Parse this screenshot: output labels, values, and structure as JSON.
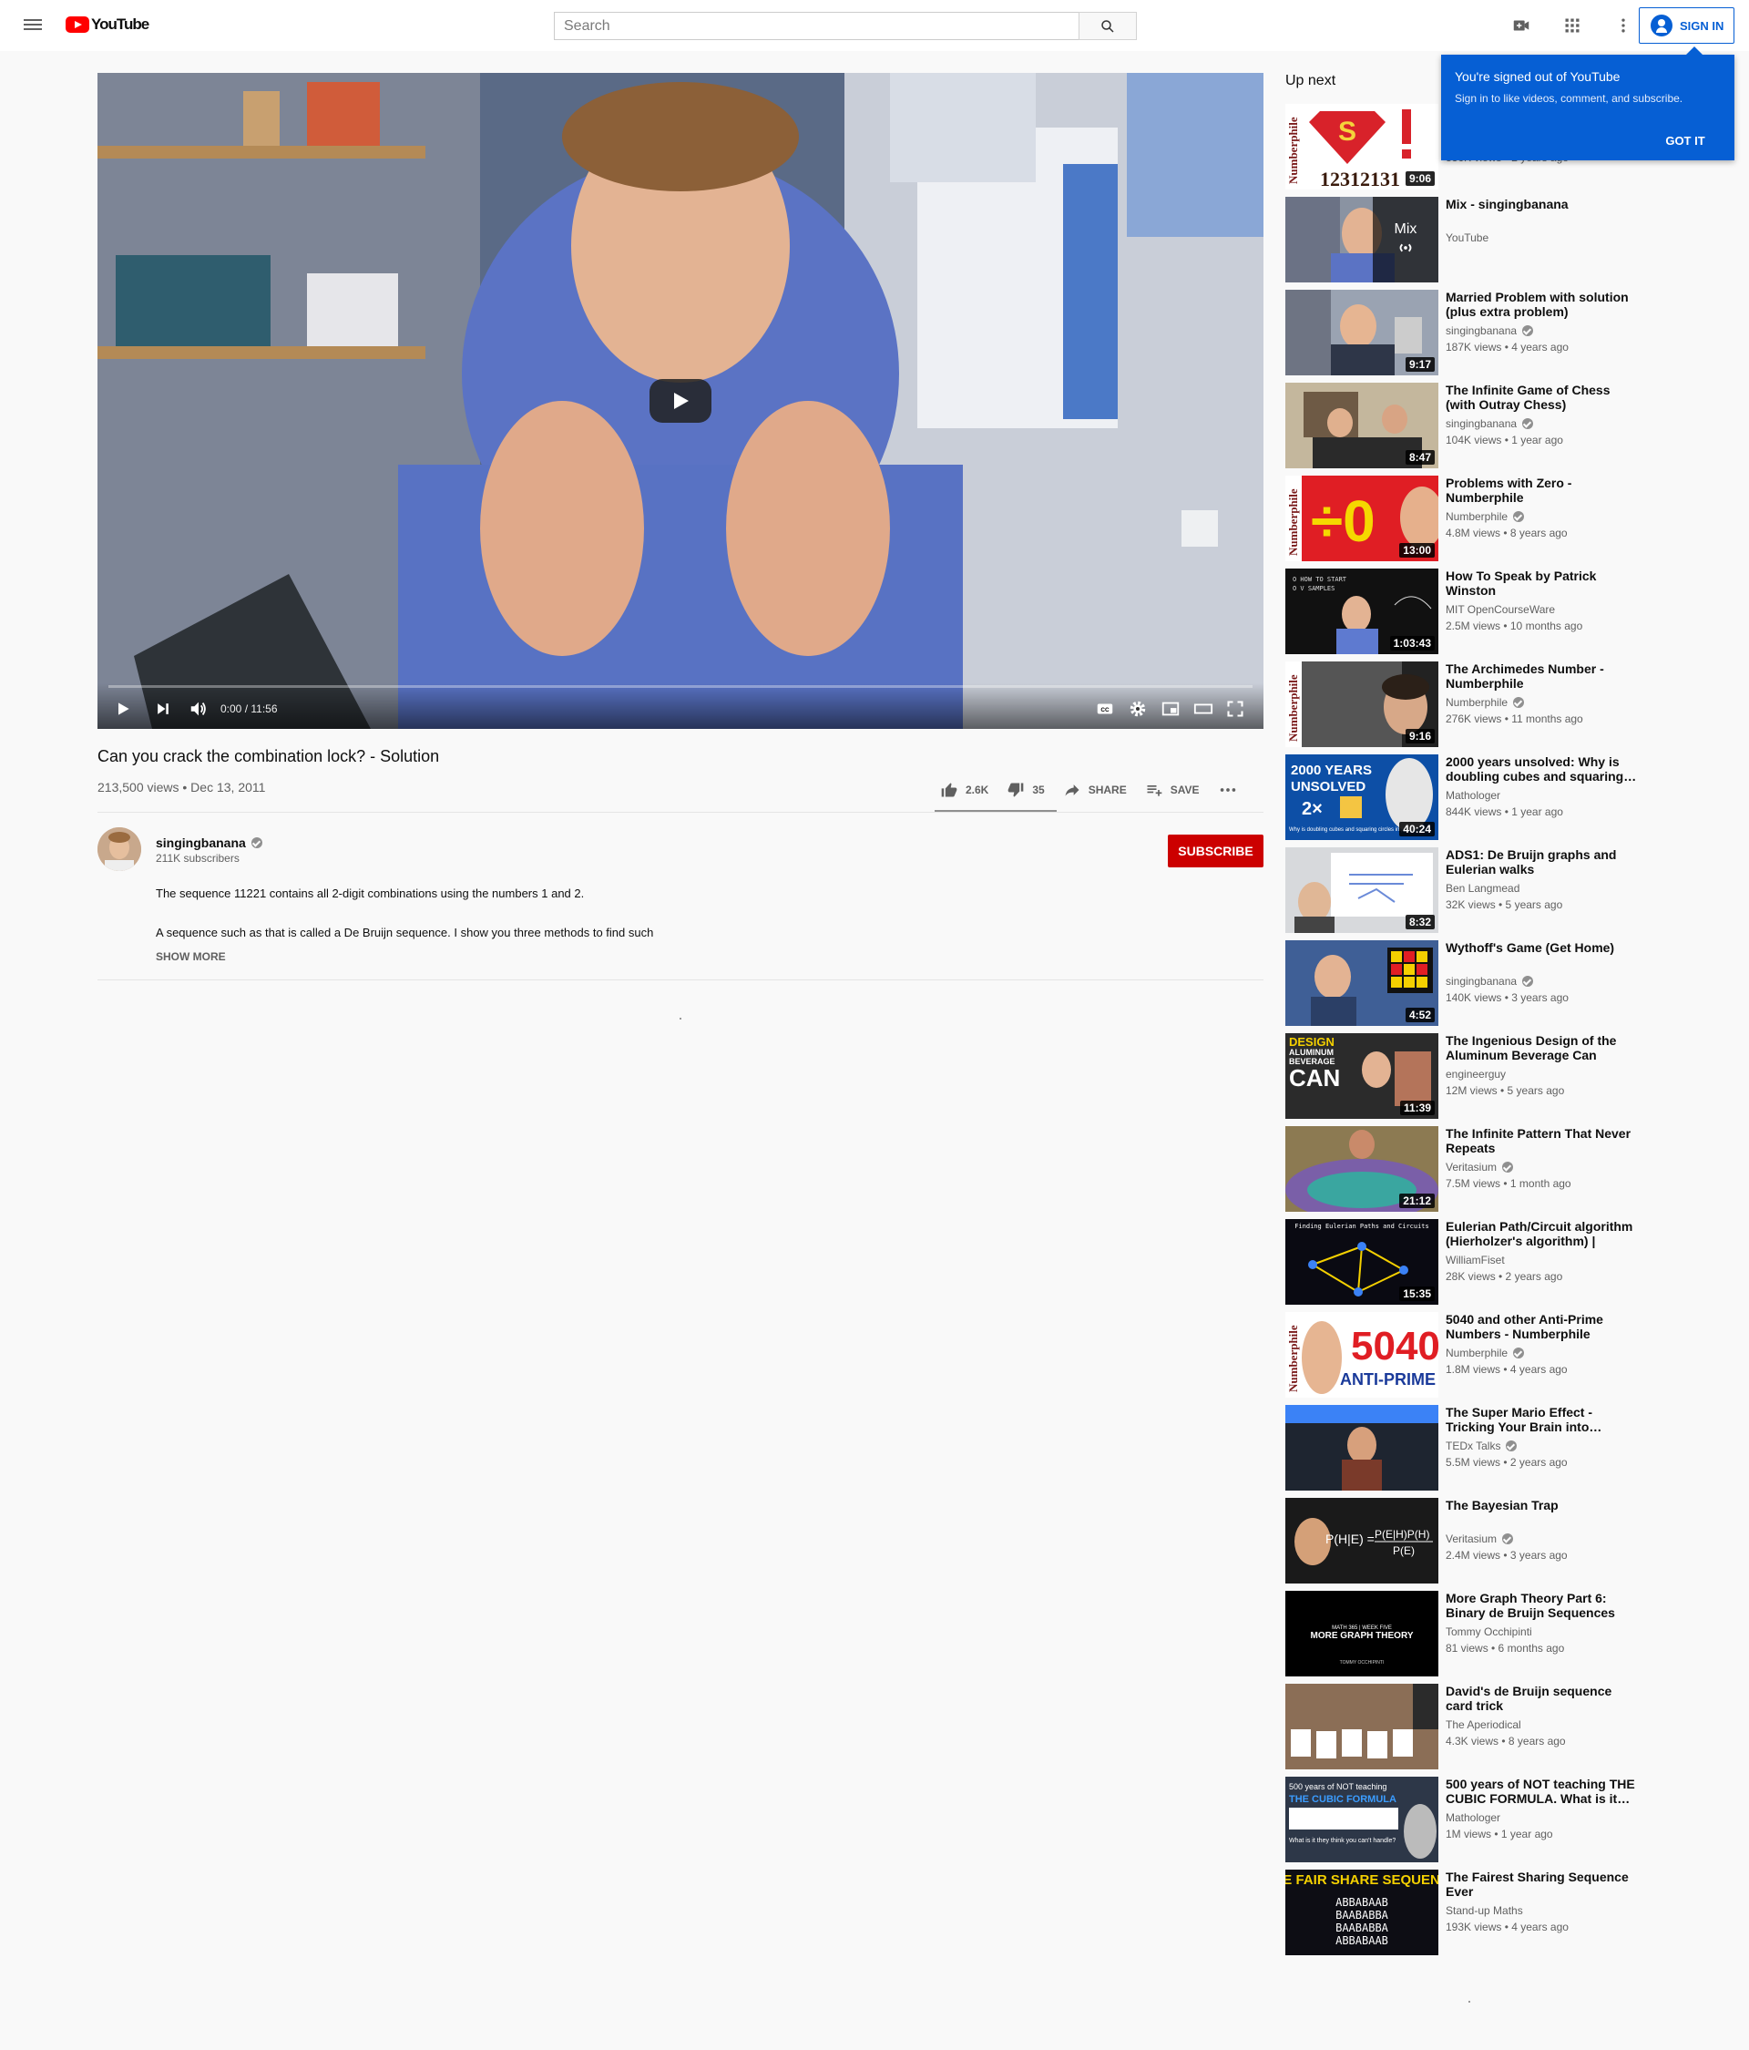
{
  "header": {
    "logo_text": "YouTube",
    "search_placeholder": "Search",
    "sign_in_label": "SIGN IN",
    "accent": "#065fd4",
    "brand": "#ff0000"
  },
  "player": {
    "current_time": "0:00",
    "duration": "11:56",
    "time_text": "0:00 / 11:56",
    "progress": 0
  },
  "video": {
    "title": "Can you crack the combination lock? - Solution",
    "meta": "213,500 views • Dec 13, 2011",
    "likes": "2.6K",
    "dislikes": "35",
    "share_label": "SHARE",
    "save_label": "SAVE"
  },
  "owner": {
    "name": "singingbanana",
    "subscribers": "211K subscribers",
    "subscribe_label": "SUBSCRIBE"
  },
  "description": {
    "line1": "The sequence 11221 contains all 2-digit combinations using the numbers 1 and 2.",
    "line2": "A sequence such as that is called a De Bruijn sequence. I show you three methods to find such",
    "show_more": "SHOW MORE"
  },
  "signin_popup": {
    "title": "You're signed out of YouTube",
    "body": "Sign in to like videos, comment, and subscribe.",
    "button": "GOT IT"
  },
  "sidebar": {
    "up_next_label": "Up next",
    "items": [
      {
        "title": "",
        "channel": "",
        "stats": "336K views • 2 years ago",
        "duration": "9:06",
        "verified": false
      },
      {
        "title": "Mix - singingbanana",
        "channel": "YouTube",
        "stats": "",
        "duration": "",
        "verified": false,
        "mix_label": "Mix"
      },
      {
        "title": "Married Problem with solution (plus extra problem)",
        "channel": "singingbanana",
        "stats": "187K views • 4 years ago",
        "duration": "9:17",
        "verified": true
      },
      {
        "title": "The Infinite Game of Chess (with Outray Chess)",
        "channel": "singingbanana",
        "stats": "104K views • 1 year ago",
        "duration": "8:47",
        "verified": true
      },
      {
        "title": "Problems with Zero - Numberphile",
        "channel": "Numberphile",
        "stats": "4.8M views • 8 years ago",
        "duration": "13:00",
        "verified": true
      },
      {
        "title": "How To Speak by Patrick Winston",
        "channel": "MIT OpenCourseWare",
        "stats": "2.5M views • 10 months ago",
        "duration": "1:03:43",
        "verified": false
      },
      {
        "title": "The Archimedes Number - Numberphile",
        "channel": "Numberphile",
        "stats": "276K views • 11 months ago",
        "duration": "9:16",
        "verified": true
      },
      {
        "title": "2000 years unsolved: Why is doubling cubes and squaring…",
        "channel": "Mathologer",
        "stats": "844K views • 1 year ago",
        "duration": "40:24",
        "verified": false
      },
      {
        "title": "ADS1: De Bruijn graphs and Eulerian walks",
        "channel": "Ben Langmead",
        "stats": "32K views • 5 years ago",
        "duration": "8:32",
        "verified": false
      },
      {
        "title": "Wythoff's Game (Get Home)",
        "channel": "singingbanana",
        "stats": "140K views • 3 years ago",
        "duration": "4:52",
        "verified": true
      },
      {
        "title": "The Ingenious Design of the Aluminum Beverage Can",
        "channel": "engineerguy",
        "stats": "12M views • 5 years ago",
        "duration": "11:39",
        "verified": false
      },
      {
        "title": "The Infinite Pattern That Never Repeats",
        "channel": "Veritasium",
        "stats": "7.5M views • 1 month ago",
        "duration": "21:12",
        "verified": true
      },
      {
        "title": "Eulerian Path/Circuit algorithm (Hierholzer's algorithm) | Grap…",
        "channel": "WilliamFiset",
        "stats": "28K views • 2 years ago",
        "duration": "15:35",
        "verified": false
      },
      {
        "title": "5040 and other Anti-Prime Numbers - Numberphile",
        "channel": "Numberphile",
        "stats": "1.8M views • 4 years ago",
        "duration": "",
        "verified": true
      },
      {
        "title": "The Super Mario Effect - Tricking Your Brain into…",
        "channel": "TEDx Talks",
        "stats": "5.5M views • 2 years ago",
        "duration": "",
        "verified": true
      },
      {
        "title": "The Bayesian Trap",
        "channel": "Veritasium",
        "stats": "2.4M views • 3 years ago",
        "duration": "",
        "verified": true
      },
      {
        "title": "More Graph Theory Part 6: Binary de Bruijn Sequences",
        "channel": "Tommy Occhipinti",
        "stats": "81 views • 6 months ago",
        "duration": "",
        "verified": false
      },
      {
        "title": "David's de Bruijn sequence card trick",
        "channel": "The Aperiodical",
        "stats": "4.3K views • 8 years ago",
        "duration": "",
        "verified": false
      },
      {
        "title": "500 years of NOT teaching THE CUBIC FORMULA. What is it…",
        "channel": "Mathologer",
        "stats": "1M views • 1 year ago",
        "duration": "",
        "verified": false
      },
      {
        "title": "The Fairest Sharing Sequence Ever",
        "channel": "Stand-up Maths",
        "stats": "193K views • 4 years ago",
        "duration": "",
        "verified": false
      }
    ]
  },
  "thumb_text": {
    "numberphile": "Numberphile",
    "t0_digits": "12312131",
    "t4_big": "÷0",
    "t7_line1": "2000 YEARS",
    "t7_line2": "UNSOLVED",
    "t7_caption": "Why is doubling cubes and squaring circles impossible?",
    "t10_design": "DESIGN",
    "t10_aluminum": "ALUMINUM",
    "t10_beverage": "BEVERAGE",
    "t10_can": "CAN",
    "t12_heading": "Finding Eulerian Paths and Circuits",
    "t13_big": "5040",
    "t13_sub": "ANTI-PRIME",
    "t15_left": "P(H|E) =",
    "t15_num": "P(E|H)P(H)",
    "t15_den": "P(E)",
    "t16_small": "MATH 365 | WEEK FIVE",
    "t16_big": "MORE GRAPH THEORY",
    "t16_author": "TOMMY OCCHIPINTI",
    "t18_top": "500 years of NOT teaching",
    "t18_mid": "THE CUBIC FORMULA",
    "t18_q": "What is it they think you can't handle?",
    "t19_title": "THE FAIR SHARE SEQUENCE",
    "t19_rows": [
      "ABBABAAB",
      "BAABABBA",
      "BAABABBA",
      "ABBABAAB"
    ]
  }
}
